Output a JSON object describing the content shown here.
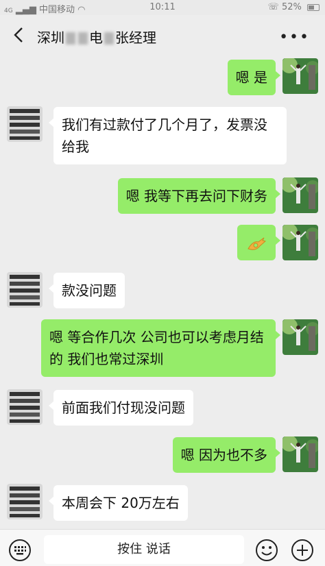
{
  "status_bar": {
    "network": "4G",
    "carrier": "中国移动",
    "time": "10:11",
    "battery": "52%",
    "battery_level": 0.52
  },
  "header": {
    "title_part1": "深圳",
    "title_part2": "电",
    "title_part3": "张经理",
    "more_label": "•••"
  },
  "messages": [
    {
      "from": "self",
      "text": "嗯 是"
    },
    {
      "from": "other",
      "text": "我们有过款付了几个月了，发票没给我"
    },
    {
      "from": "self",
      "text": "嗯  我等下再去问下财务"
    },
    {
      "from": "self",
      "text": "👌"
    },
    {
      "from": "other",
      "text": "款没问题"
    },
    {
      "from": "self",
      "text": "嗯 等合作几次  公司也可以考虑月结的  我们也常过深圳"
    },
    {
      "from": "other",
      "text": "前面我们付现没问题"
    },
    {
      "from": "self",
      "text": "嗯 因为也不多"
    },
    {
      "from": "other",
      "text": "本周会下 20万左右"
    }
  ],
  "input": {
    "hold_to_talk": "按住 说话"
  }
}
